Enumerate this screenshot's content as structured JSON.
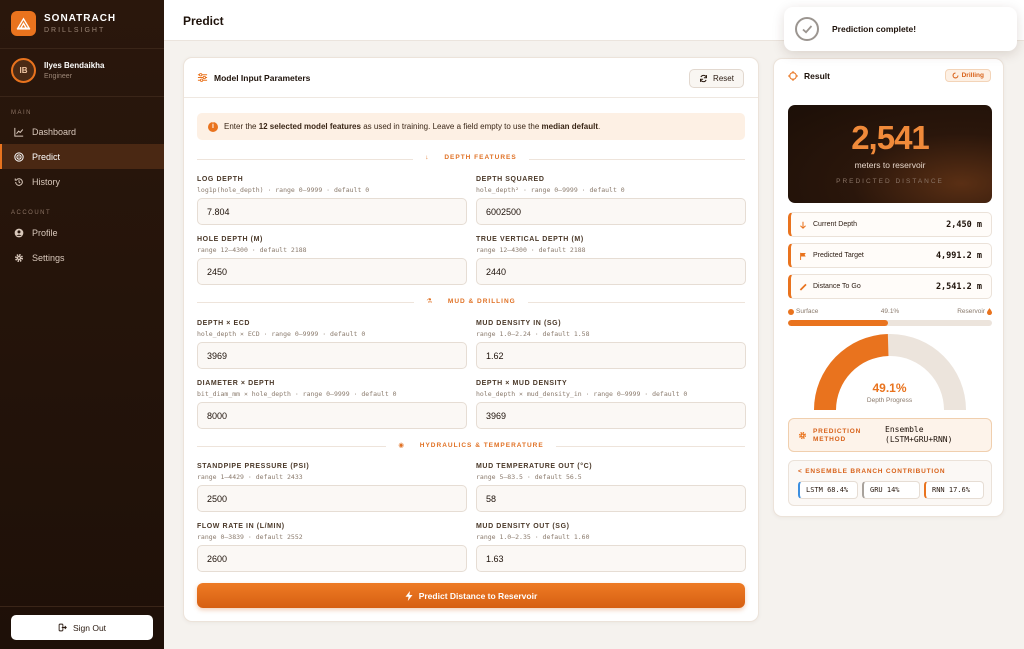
{
  "brand": {
    "name": "SONATRACH",
    "subtitle": "DRILLSIGHT"
  },
  "user": {
    "initials": "IB",
    "name": "Ilyes Bendaikha",
    "role": "Engineer"
  },
  "nav": {
    "main_label": "MAIN",
    "account_label": "ACCOUNT",
    "items": [
      {
        "label": "Dashboard",
        "icon": "chart-line-icon"
      },
      {
        "label": "Predict",
        "icon": "target-icon",
        "active": true
      },
      {
        "label": "History",
        "icon": "history-icon"
      }
    ],
    "account_items": [
      {
        "label": "Profile",
        "icon": "user-circle-icon"
      },
      {
        "label": "Settings",
        "icon": "gear-icon"
      }
    ],
    "signout_label": "Sign Out"
  },
  "header": {
    "title": "Predict"
  },
  "toast": {
    "message": "Prediction complete!"
  },
  "input_card": {
    "title": "Model Input Parameters",
    "reset_label": "Reset",
    "info": {
      "prefix": "Enter the ",
      "bold1": "12 selected model features",
      "middle": " as used in training. Leave a field empty to use the ",
      "bold2": "median default",
      "suffix": "."
    },
    "sections": [
      {
        "label": "DEPTH FEATURES",
        "icon": "↓"
      },
      {
        "label": "MUD & DRILLING",
        "icon": "⚗"
      },
      {
        "label": "HYDRAULICS & TEMPERATURE",
        "icon": "◉"
      }
    ],
    "fields": [
      {
        "label": "LOG DEPTH",
        "hint": "log1p(hole_depth) · range 0–9999 · default 0",
        "value": "7.804"
      },
      {
        "label": "DEPTH SQUARED",
        "hint": "hole_depth² · range 0–9999 · default 0",
        "value": "6002500"
      },
      {
        "label": "HOLE DEPTH (M)",
        "hint": "range 12–4300 · default 2188",
        "value": "2450"
      },
      {
        "label": "TRUE VERTICAL DEPTH (M)",
        "hint": "range 12–4300 · default 2188",
        "value": "2440"
      },
      {
        "label": "DEPTH × ECD",
        "hint": "hole_depth × ECD · range 0–9999 · default 0",
        "value": "3969"
      },
      {
        "label": "MUD DENSITY IN (SG)",
        "hint": "range 1.0–2.24 · default 1.58",
        "value": "1.62"
      },
      {
        "label": "DIAMETER × DEPTH",
        "hint": "bit_diam_mm × hole_depth · range 0–9999 · default 0",
        "value": "8000"
      },
      {
        "label": "DEPTH × MUD DENSITY",
        "hint": "hole_depth × mud_density_in · range 0–9999 · default 0",
        "value": "3969"
      },
      {
        "label": "STANDPIPE PRESSURE (PSI)",
        "hint": "range 1–4429 · default 2433",
        "value": "2500"
      },
      {
        "label": "MUD TEMPERATURE OUT (°C)",
        "hint": "range 5–83.5 · default 56.5",
        "value": "58"
      },
      {
        "label": "FLOW RATE IN (L/MIN)",
        "hint": "range 0–3839 · default 2552",
        "value": "2600"
      },
      {
        "label": "MUD DENSITY OUT (SG)",
        "hint": "range 1.0–2.35 · default 1.60",
        "value": "1.63"
      }
    ],
    "predict_label": "Predict Distance to Reservoir"
  },
  "result": {
    "title": "Result",
    "badge": "Drilling",
    "big_value": "2,541",
    "big_unit": "meters to reservoir",
    "big_caption": "PREDICTED DISTANCE",
    "metrics": [
      {
        "label": "Current Depth",
        "value": "2,450 m",
        "icon": "arrow-down-icon"
      },
      {
        "label": "Predicted Target",
        "value": "4,991.2 m",
        "icon": "flag-icon"
      },
      {
        "label": "Distance To Go",
        "value": "2,541.2 m",
        "icon": "ruler-icon"
      }
    ],
    "progress": {
      "start_label": "Surface",
      "percent_label": "49.1%",
      "end_label": "Reservoir",
      "fraction": 0.491
    },
    "gauge": {
      "value": "49.1%",
      "label": "Depth Progress",
      "fraction": 0.491
    },
    "method": {
      "label": "PREDICTION METHOD",
      "value_line1": "Ensemble",
      "value_line2": "(LSTM+GRU+RNN)"
    },
    "branch": {
      "title": "ENSEMBLE BRANCH CONTRIBUTION",
      "chips": [
        {
          "label": "LSTM 68.4%",
          "color": "#3d8fe0"
        },
        {
          "label": "GRU 14%",
          "color": "#a8a29c"
        },
        {
          "label": "RNN 17.6%",
          "color": "#e9731e"
        }
      ]
    }
  },
  "colors": {
    "accent": "#e9731e",
    "sidebar": "#24130a",
    "gauge_track": "#ece4dc"
  }
}
